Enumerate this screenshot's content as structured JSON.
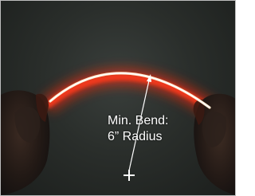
{
  "annotation": {
    "line1": "Min. Bend:",
    "line2": "6” Radius"
  },
  "icons": [
    "center-cross-icon",
    "arrow-icon"
  ],
  "colors": {
    "glow": "#ff3a1a",
    "strip": "#fff4e0",
    "background": "#2a2e2b"
  }
}
